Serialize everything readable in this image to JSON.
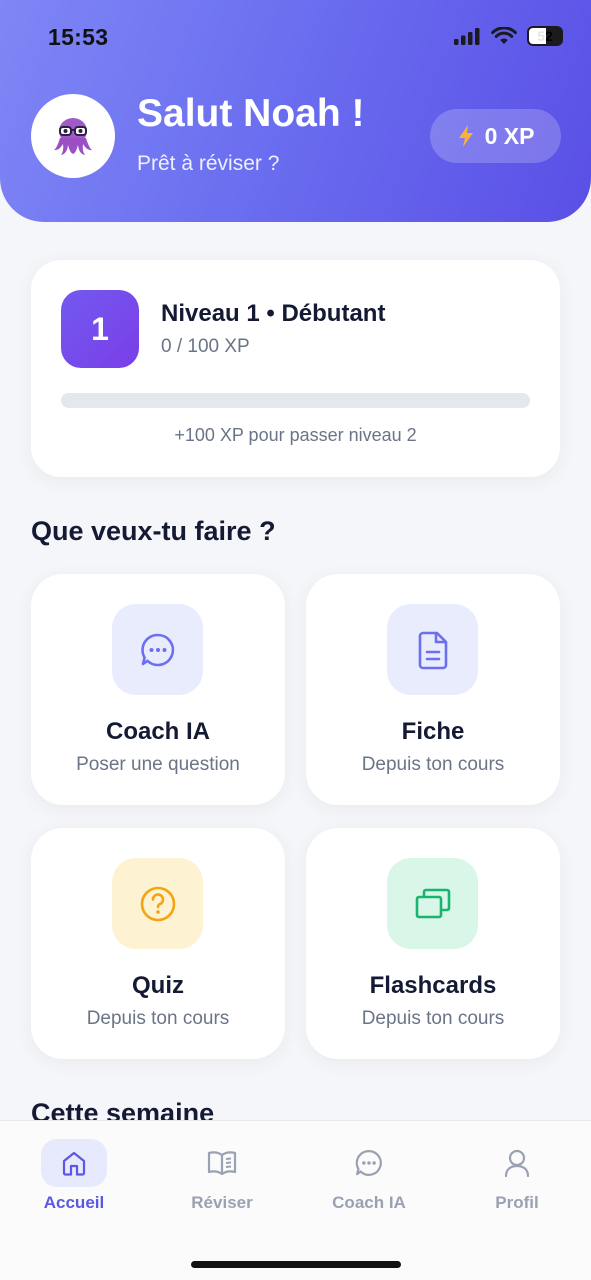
{
  "status_bar": {
    "time": "15:53",
    "battery": "52"
  },
  "header": {
    "greeting": "Salut Noah !",
    "subtitle": "Prêt à réviser ?",
    "xp_label": "0 XP",
    "accent": "#6b6ff0"
  },
  "level": {
    "number": "1",
    "title": "Niveau 1 • Débutant",
    "xp_text": "0 / 100 XP",
    "progress": 0,
    "hint": "+100 XP pour passer niveau 2"
  },
  "actions_section": {
    "title": "Que veux-tu faire ?"
  },
  "actions": [
    {
      "title": "Coach IA",
      "subtitle": "Poser une question",
      "icon": "chat-bubble-icon",
      "icon_color": "#6b6ff0",
      "icon_bg": "#e9ecfd"
    },
    {
      "title": "Fiche",
      "subtitle": "Depuis ton cours",
      "icon": "document-icon",
      "icon_color": "#6b6ff0",
      "icon_bg": "#e9ecfd"
    },
    {
      "title": "Quiz",
      "subtitle": "Depuis ton cours",
      "icon": "question-circle-icon",
      "icon_color": "#f2a413",
      "icon_bg": "#fdf3d2"
    },
    {
      "title": "Flashcards",
      "subtitle": "Depuis ton cours",
      "icon": "cards-icon",
      "icon_color": "#19b46f",
      "icon_bg": "#d9f7e8"
    }
  ],
  "week_section": {
    "title": "Cette semaine"
  },
  "tabbar": {
    "tabs": [
      {
        "label": "Accueil",
        "icon": "home-icon",
        "active": true
      },
      {
        "label": "Réviser",
        "icon": "book-icon",
        "active": false
      },
      {
        "label": "Coach IA",
        "icon": "chat-bubble-icon",
        "active": false
      },
      {
        "label": "Profil",
        "icon": "user-icon",
        "active": false
      }
    ]
  }
}
